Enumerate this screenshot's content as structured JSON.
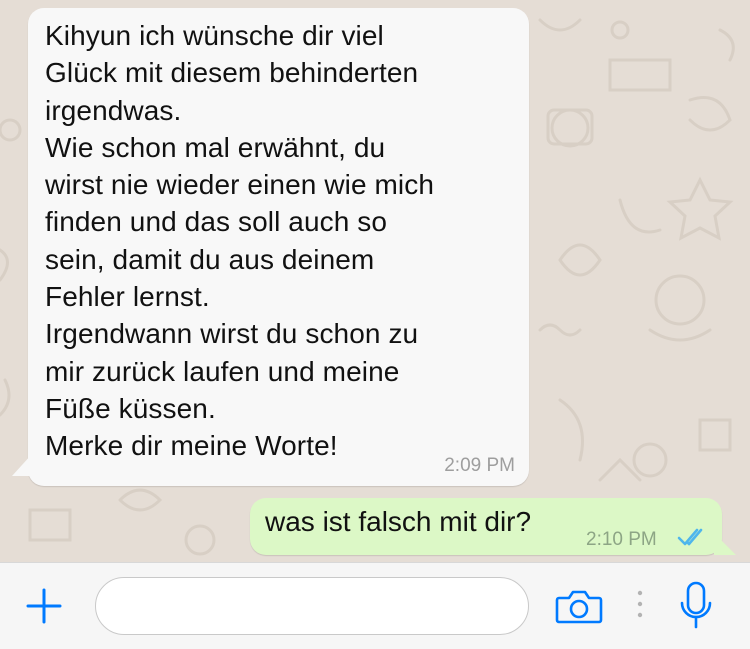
{
  "chat": {
    "incoming": {
      "text": "Kihyun ich wünsche dir viel\nGlück mit diesem behinderten\nirgendwas.\nWie schon mal erwähnt, du\nwirst nie wieder einen wie mich\nfinden und das soll auch so\nsein, damit du aus deinem\nFehler lernst.\nIrgendwann wirst du schon zu\nmir zurück laufen und meine\nFüße küssen.\nMerke dir meine Worte!",
      "time": "2:09 PM"
    },
    "outgoing": {
      "text": "was ist falsch mit dir?",
      "time": "2:10 PM",
      "status_icon": "double-check-read-icon"
    }
  },
  "composer": {
    "placeholder": "",
    "value": "",
    "icons": [
      "plus-icon",
      "camera-icon",
      "more-dots-icon",
      "microphone-icon"
    ]
  },
  "colors": {
    "accent": "#007aff",
    "incoming_bubble": "#f8f8f8",
    "outgoing_bubble": "#dcf8c6",
    "chat_background": "#e5ddd5",
    "read_ticks": "#4fb6ec"
  }
}
